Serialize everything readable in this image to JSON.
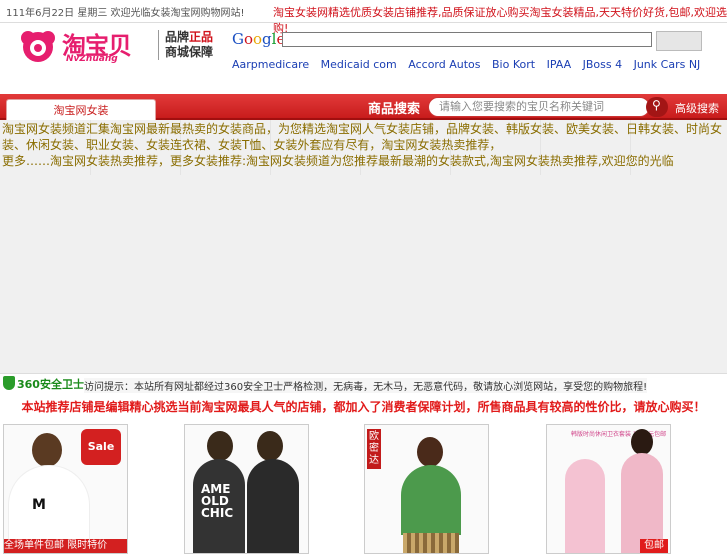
{
  "top": {
    "date_note": "111年6月22日 星期三 欢迎光临女装淘宝网购物网站!",
    "marquee": "淘宝女装网精选优质女装店铺推荐,品质保证放心购买淘宝女装精品,天天特价好货,包邮,欢迎选购!"
  },
  "logo": {
    "main": "淘宝贝",
    "sub": "NvZhuang",
    "slogan_line1_a": "品牌",
    "slogan_line1_b": "正品",
    "slogan_line2": "商城保障"
  },
  "google": {
    "logo_letters": [
      "G",
      "o",
      "o",
      "g",
      "l",
      "e"
    ],
    "search_value": "",
    "button_label": "",
    "ad_links": [
      "Aarpmedicare",
      "Medicaid com",
      "Accord Autos",
      "Bio Kort",
      "IPAA",
      "JBoss 4",
      "Junk Cars NJ"
    ]
  },
  "nav": {
    "tab_label": "淘宝网女装",
    "search_label": "商品搜索",
    "search_placeholder": "请输入您要搜索的宝贝名称关键词",
    "extra_label": "高级搜索"
  },
  "content": {
    "line1": "淘宝网女装频道汇集淘宝网最新最热卖的女装商品，为您精选淘宝网人气女装店铺，品牌女装、韩版女装、欧美女装、日韩女装、时尚女装、休闲女装、职业女装、女装连衣裙、女装T恤、女装外套应有尽有，淘宝网女装热卖推荐，",
    "line2": "更多……淘宝网女装热卖推荐，更多女装推荐:淘宝网女装频道为您推荐最新最潮的女装款式,淘宝网女装热卖推荐,欢迎您的光临"
  },
  "safety": {
    "title": "360安全卫士",
    "note": "访问提示：本站所有网址都经过360安全卫士严格检测，无病毒，无木马，无恶意代码，敬请放心浏览网站，享受您的购物旅程!"
  },
  "recommend": "本站推荐店铺是编辑精心挑选当前淘宝网最具人气的店铺，都加入了消费者保障计划，所售商品具有较高的性价比，请放心购买！",
  "products": [
    {
      "badge": "Sale",
      "strip": "全场单件包邮  限时特价",
      "colors": {
        "shirt": "#ffffff",
        "print": "#111111"
      }
    },
    {
      "colors": {
        "shirt": "#333333"
      }
    },
    {
      "tag": "欧密达",
      "colors": {
        "shirt": "#4c9a4c"
      }
    },
    {
      "note": "韩版时尚休闲卫衣套装 1999元包邮",
      "baoyou": "包邮",
      "colors": {
        "shirt": "#f4c2d2"
      }
    }
  ],
  "colors": {
    "nav_red": "#c81c1c",
    "marquee_red": "#d0121b",
    "link_blue": "#1a3eb3",
    "text_olive": "#8a6d00",
    "safe_green": "#1a8a1a"
  }
}
